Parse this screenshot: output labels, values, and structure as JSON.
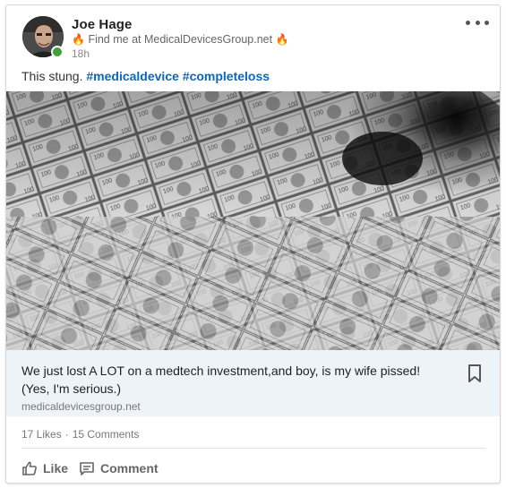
{
  "post": {
    "author": {
      "name": "Joe Hage",
      "headline": "Find me at MedicalDevicesGroup.net",
      "headline_emoji": "🔥",
      "time": "18h",
      "online": true
    },
    "text": "This stung.",
    "hashtags": [
      "#medicaldevice",
      "#completeloss"
    ],
    "image_icon": "money-vortex-photo",
    "link": {
      "title": "We just lost A LOT on a medtech investment,and boy, is my wife pissed! (Yes, I'm serious.)",
      "domain": "medicaldevicesgroup.net"
    },
    "social": {
      "likes": "17 Likes",
      "separator": "·",
      "comments": "15 Comments"
    },
    "actions": {
      "like": "Like",
      "comment": "Comment"
    },
    "colors": {
      "hashtag": "#0a66c2",
      "presence": "#3ea23a",
      "link_bg": "#eef3f8"
    }
  }
}
